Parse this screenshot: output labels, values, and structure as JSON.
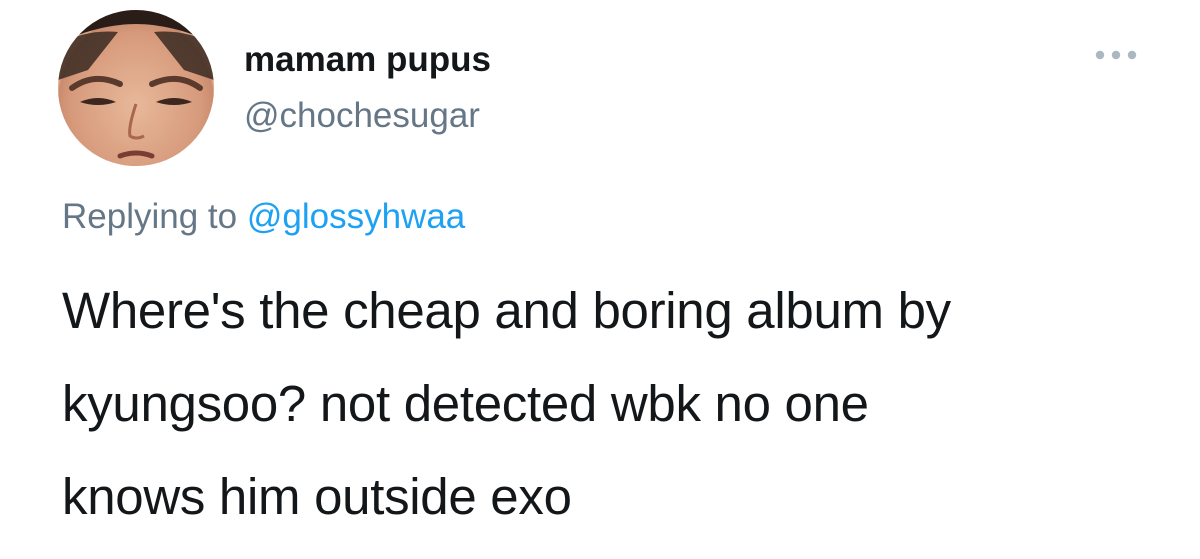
{
  "tweet": {
    "author": {
      "display_name": "mamam pupus",
      "handle": "@chochesugar",
      "avatar_icon": "person-face-avatar"
    },
    "more_icon": "more-horizontal-icon",
    "reply": {
      "prefix": "Replying to",
      "mention": "@glossyhwaa"
    },
    "text_lines": [
      "Where's the cheap and boring album by",
      "kyungsoo? not detected wbk no one",
      "knows him outside exo"
    ]
  },
  "colors": {
    "text_primary": "#14171a",
    "text_secondary": "#657786",
    "link": "#1da1f2",
    "background": "#ffffff"
  }
}
